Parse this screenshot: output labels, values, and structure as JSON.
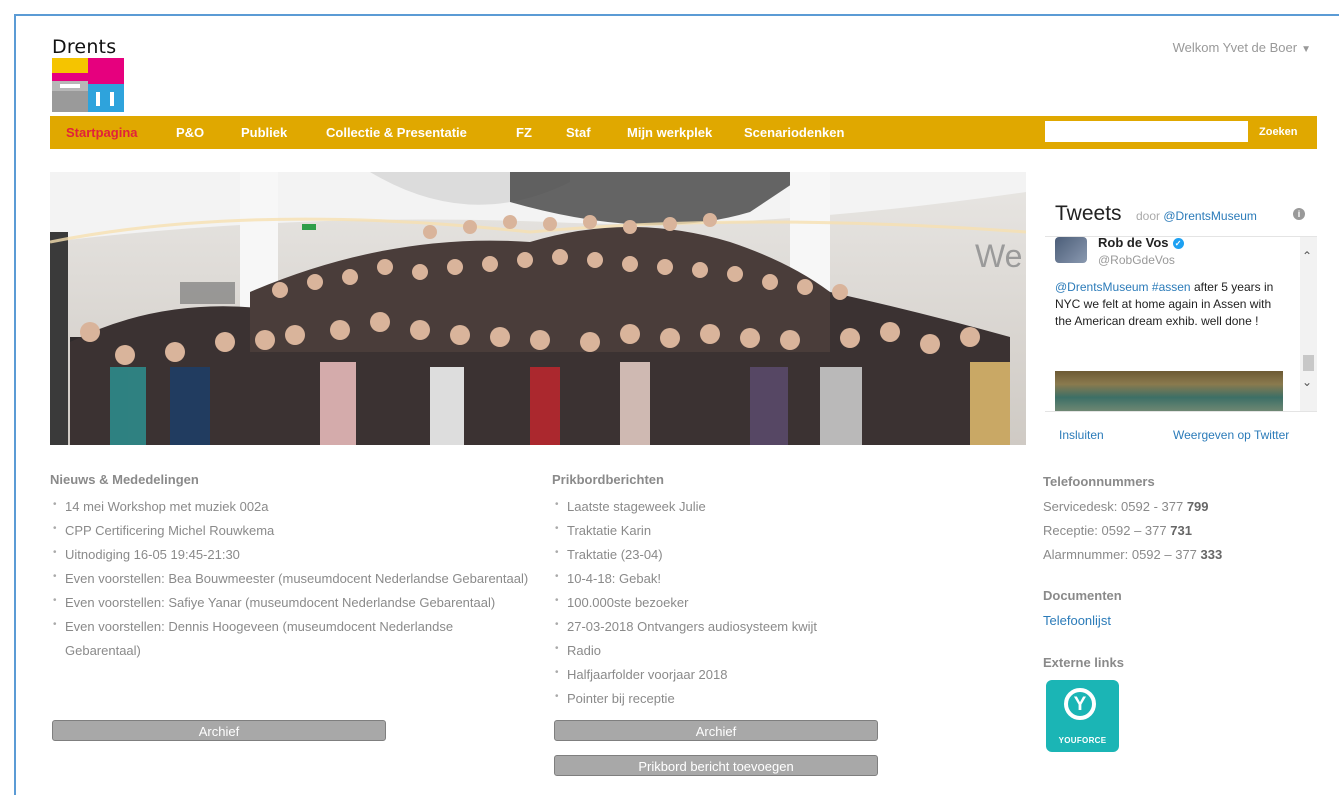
{
  "header": {
    "logo_text": "Drents",
    "welcome": "Welkom Yvet de Boer"
  },
  "nav": {
    "items": [
      {
        "label": "Startpagina",
        "active": true
      },
      {
        "label": "P&O"
      },
      {
        "label": "Publiek"
      },
      {
        "label": "Collectie & Presentatie"
      },
      {
        "label": "FZ"
      },
      {
        "label": "Staf"
      },
      {
        "label": "Mijn werkplek"
      },
      {
        "label": "Scenariodenken"
      }
    ],
    "search_value": "",
    "search_button": "Zoeken",
    "bar_color": "#e0a800"
  },
  "news": {
    "title": "Nieuws & Mededelingen",
    "items": [
      "14 mei Workshop met muziek 002a",
      "CPP Certificering Michel Rouwkema",
      "Uitnodiging 16-05 19:45-21:30",
      "Even voorstellen: Bea Bouwmeester (museumdocent Nederlandse Gebarentaal)",
      "Even voorstellen: Safiye Yanar (museumdocent Nederlandse Gebarentaal)",
      "Even voorstellen: Dennis Hoogeveen (museumdocent Nederlandse Gebarentaal)"
    ],
    "archive_button": "Archief"
  },
  "board": {
    "title": "Prikbordberichten",
    "items": [
      "Laatste stageweek Julie",
      "Traktatie Karin",
      "Traktatie (23-04)",
      "10-4-18: Gebak!",
      "100.000ste bezoeker",
      "27-03-2018 Ontvangers audiosysteem kwijt",
      "Radio",
      "Halfjaarfolder voorjaar 2018",
      "Pointer bij receptie"
    ],
    "archive_button": "Archief",
    "add_button": "Prikbord bericht toevoegen"
  },
  "tweets": {
    "title": "Tweets",
    "by_prefix": "door",
    "by_handle": "@DrentsMuseum",
    "author_name": "Rob de Vos",
    "author_handle": "@RobGdeVos",
    "text_mention": "@DrentsMuseum",
    "text_hashtag": "#assen",
    "text_rest": "after 5 years in NYC we felt at home again in Assen with the American dream exhib. well done !",
    "embed_link": "Insluiten",
    "view_link": "Weergeven op Twitter"
  },
  "phones": {
    "title": "Telefoonnummers",
    "items": [
      {
        "label": "Servicedesk: 0592 - 377",
        "ext": "799"
      },
      {
        "label": "Receptie: 0592 – 377",
        "ext": "731"
      },
      {
        "label": "Alarmnummer: 0592 – 377",
        "ext": "333"
      }
    ]
  },
  "documents": {
    "title": "Documenten",
    "items": [
      "Telefoonlijst"
    ]
  },
  "external": {
    "title": "Externe links",
    "youforce_label": "YOUFORCE",
    "youforce_letter": "Y"
  }
}
